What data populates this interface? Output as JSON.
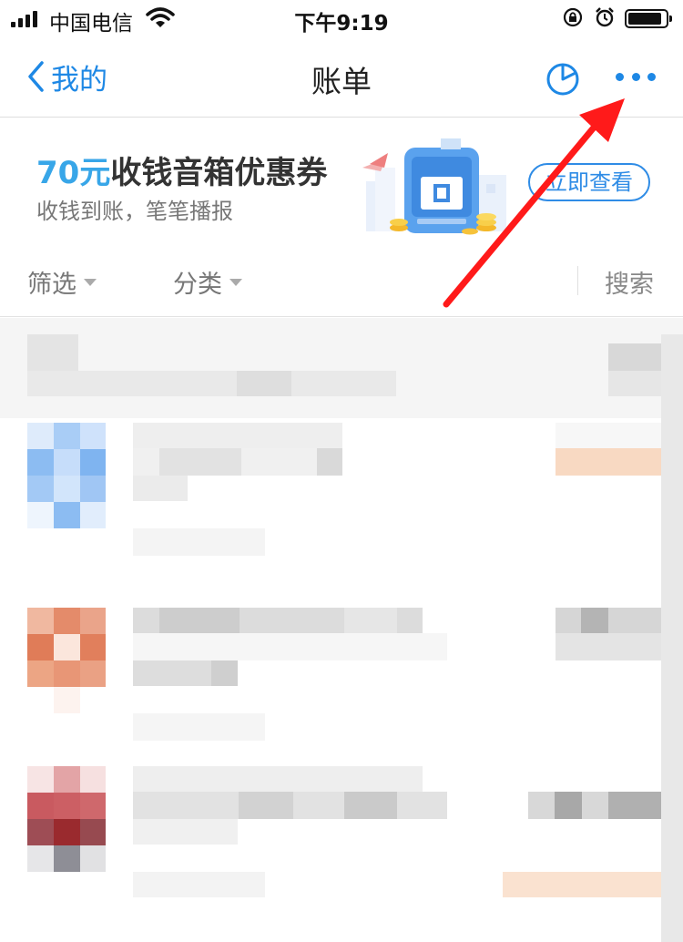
{
  "status_bar": {
    "carrier": "中国电信",
    "time": "下午9:19"
  },
  "nav": {
    "back_label": "我的",
    "title": "账单",
    "icons": [
      "back-chevron-icon",
      "pie-chart-icon",
      "more-icon"
    ]
  },
  "banner": {
    "amount": "70元",
    "title": "收钱音箱优惠券",
    "subtitle": "收钱到账，笔笔播报",
    "button_label": "立即查看"
  },
  "filters": {
    "filter_label": "筛选",
    "category_label": "分类",
    "search_label": "搜索"
  },
  "list": {
    "note": "",
    "obscured": true
  },
  "colors": {
    "accent": "#1e88e5",
    "promo_amount": "#38a6e8",
    "annotation_arrow": "#ff1a1a"
  }
}
